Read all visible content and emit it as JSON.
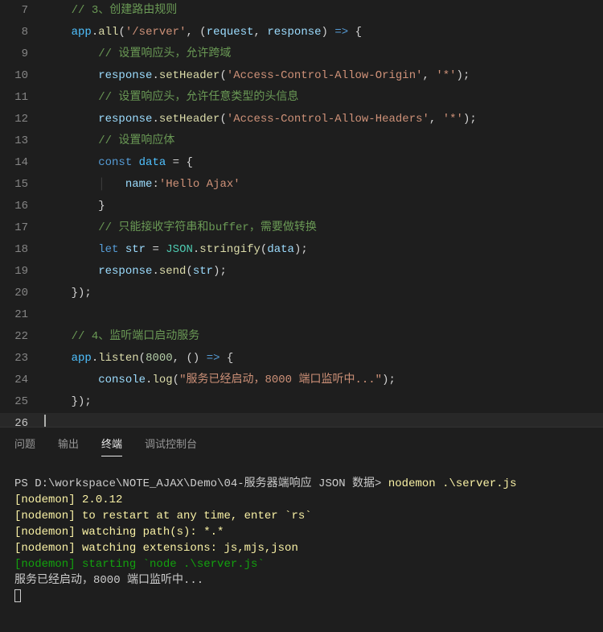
{
  "lines": [
    {
      "n": 7,
      "segs": [
        {
          "t": "    ",
          "c": "pn"
        },
        {
          "t": "// 3、创建路由规则",
          "c": "cm"
        }
      ]
    },
    {
      "n": 8,
      "segs": [
        {
          "t": "    ",
          "c": "pn"
        },
        {
          "t": "app",
          "c": "cn"
        },
        {
          "t": ".",
          "c": "pn"
        },
        {
          "t": "all",
          "c": "fn"
        },
        {
          "t": "(",
          "c": "pn"
        },
        {
          "t": "'/server'",
          "c": "st"
        },
        {
          "t": ", (",
          "c": "pn"
        },
        {
          "t": "request",
          "c": "vr"
        },
        {
          "t": ", ",
          "c": "pn"
        },
        {
          "t": "response",
          "c": "vr"
        },
        {
          "t": ") ",
          "c": "pn"
        },
        {
          "t": "=>",
          "c": "kw"
        },
        {
          "t": " {",
          "c": "pn"
        }
      ]
    },
    {
      "n": 9,
      "segs": [
        {
          "t": "        ",
          "c": "pn"
        },
        {
          "t": "// 设置响应头，允许跨域",
          "c": "cm"
        }
      ]
    },
    {
      "n": 10,
      "segs": [
        {
          "t": "        ",
          "c": "pn"
        },
        {
          "t": "response",
          "c": "vr"
        },
        {
          "t": ".",
          "c": "pn"
        },
        {
          "t": "setHeader",
          "c": "fn"
        },
        {
          "t": "(",
          "c": "pn"
        },
        {
          "t": "'Access-Control-Allow-Origin'",
          "c": "st"
        },
        {
          "t": ", ",
          "c": "pn"
        },
        {
          "t": "'*'",
          "c": "st"
        },
        {
          "t": ");",
          "c": "pn"
        }
      ]
    },
    {
      "n": 11,
      "segs": [
        {
          "t": "        ",
          "c": "pn"
        },
        {
          "t": "// 设置响应头，允许任意类型的头信息",
          "c": "cm"
        }
      ]
    },
    {
      "n": 12,
      "segs": [
        {
          "t": "        ",
          "c": "pn"
        },
        {
          "t": "response",
          "c": "vr"
        },
        {
          "t": ".",
          "c": "pn"
        },
        {
          "t": "setHeader",
          "c": "fn"
        },
        {
          "t": "(",
          "c": "pn"
        },
        {
          "t": "'Access-Control-Allow-Headers'",
          "c": "st"
        },
        {
          "t": ", ",
          "c": "pn"
        },
        {
          "t": "'*'",
          "c": "st"
        },
        {
          "t": ");",
          "c": "pn"
        }
      ]
    },
    {
      "n": 13,
      "segs": [
        {
          "t": "        ",
          "c": "pn"
        },
        {
          "t": "// 设置响应体",
          "c": "cm"
        }
      ]
    },
    {
      "n": 14,
      "segs": [
        {
          "t": "        ",
          "c": "pn"
        },
        {
          "t": "const",
          "c": "kw"
        },
        {
          "t": " ",
          "c": "pn"
        },
        {
          "t": "data",
          "c": "cn"
        },
        {
          "t": " = {",
          "c": "pn"
        }
      ]
    },
    {
      "n": 15,
      "segs": [
        {
          "t": "        ",
          "c": "pn"
        },
        {
          "t": "│   ",
          "c": "guide"
        },
        {
          "t": "name",
          "c": "vr"
        },
        {
          "t": ":",
          "c": "pn"
        },
        {
          "t": "'Hello Ajax'",
          "c": "st"
        }
      ]
    },
    {
      "n": 16,
      "segs": [
        {
          "t": "        }",
          "c": "pn"
        }
      ]
    },
    {
      "n": 17,
      "segs": [
        {
          "t": "        ",
          "c": "pn"
        },
        {
          "t": "// 只能接收字符串和buffer，需要做转换",
          "c": "cm"
        }
      ]
    },
    {
      "n": 18,
      "segs": [
        {
          "t": "        ",
          "c": "pn"
        },
        {
          "t": "let",
          "c": "kw"
        },
        {
          "t": " ",
          "c": "pn"
        },
        {
          "t": "str",
          "c": "vr"
        },
        {
          "t": " = ",
          "c": "pn"
        },
        {
          "t": "JSON",
          "c": "ob"
        },
        {
          "t": ".",
          "c": "pn"
        },
        {
          "t": "stringify",
          "c": "fn"
        },
        {
          "t": "(",
          "c": "pn"
        },
        {
          "t": "data",
          "c": "vr"
        },
        {
          "t": ");",
          "c": "pn"
        }
      ]
    },
    {
      "n": 19,
      "segs": [
        {
          "t": "        ",
          "c": "pn"
        },
        {
          "t": "response",
          "c": "vr"
        },
        {
          "t": ".",
          "c": "pn"
        },
        {
          "t": "send",
          "c": "fn"
        },
        {
          "t": "(",
          "c": "pn"
        },
        {
          "t": "str",
          "c": "vr"
        },
        {
          "t": ");",
          "c": "pn"
        }
      ]
    },
    {
      "n": 20,
      "segs": [
        {
          "t": "    });",
          "c": "pn"
        }
      ]
    },
    {
      "n": 21,
      "segs": [
        {
          "t": "",
          "c": "pn"
        }
      ]
    },
    {
      "n": 22,
      "segs": [
        {
          "t": "    ",
          "c": "pn"
        },
        {
          "t": "// 4、监听端口启动服务",
          "c": "cm"
        }
      ]
    },
    {
      "n": 23,
      "segs": [
        {
          "t": "    ",
          "c": "pn"
        },
        {
          "t": "app",
          "c": "cn"
        },
        {
          "t": ".",
          "c": "pn"
        },
        {
          "t": "listen",
          "c": "fn"
        },
        {
          "t": "(",
          "c": "pn"
        },
        {
          "t": "8000",
          "c": "nm"
        },
        {
          "t": ", () ",
          "c": "pn"
        },
        {
          "t": "=>",
          "c": "kw"
        },
        {
          "t": " {",
          "c": "pn"
        }
      ]
    },
    {
      "n": 24,
      "segs": [
        {
          "t": "        ",
          "c": "pn"
        },
        {
          "t": "console",
          "c": "vr"
        },
        {
          "t": ".",
          "c": "pn"
        },
        {
          "t": "log",
          "c": "fn"
        },
        {
          "t": "(",
          "c": "pn"
        },
        {
          "t": "\"服务已经启动，8000 端口监听中...\"",
          "c": "st"
        },
        {
          "t": ");",
          "c": "pn"
        }
      ]
    },
    {
      "n": 25,
      "segs": [
        {
          "t": "    });",
          "c": "pn"
        }
      ]
    },
    {
      "n": 26,
      "segs": [],
      "cursor": true
    }
  ],
  "tabs": {
    "problems": "问题",
    "output": "输出",
    "terminal": "终端",
    "debug": "调试控制台"
  },
  "terminal": [
    [
      {
        "t": "PS D:\\workspace\\NOTE_AJAX\\Demo\\04-服务器端响应 JSON 数据> ",
        "c": "tw"
      },
      {
        "t": "nodemon .\\server.js",
        "c": "ty"
      }
    ],
    [
      {
        "t": "[nodemon] 2.0.12",
        "c": "ty"
      }
    ],
    [
      {
        "t": "[nodemon] to restart at any time, enter `rs`",
        "c": "ty"
      }
    ],
    [
      {
        "t": "[nodemon] watching path(s): *.*",
        "c": "ty"
      }
    ],
    [
      {
        "t": "[nodemon] watching extensions: js,mjs,json",
        "c": "ty"
      }
    ],
    [
      {
        "t": "[nodemon] starting `node .\\server.js`",
        "c": "tg"
      }
    ],
    [
      {
        "t": "服务已经启动，8000 端口监听中...",
        "c": "tw"
      }
    ]
  ]
}
